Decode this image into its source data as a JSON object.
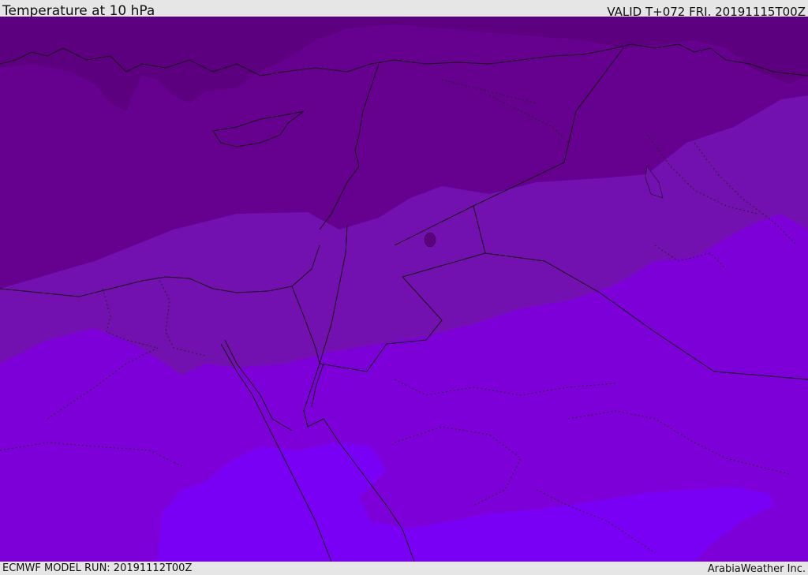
{
  "header": {
    "title": "Temperature at 10 hPa",
    "valid": "VALID T+072 FRI. 20191115T00Z"
  },
  "footer": {
    "model_run": "ECMWF MODEL RUN: 20191112T00Z",
    "credit": "ArabiaWeather Inc."
  },
  "legend_colors": {
    "band_coldest": "#5c0080",
    "band_cold": "#66008f",
    "band_mid": "#7311b0",
    "band_warm": "#7d00d9",
    "band_warmest": "#7a00f5"
  },
  "map": {
    "borders_color": "#111111",
    "boundary_style": "dotted"
  }
}
